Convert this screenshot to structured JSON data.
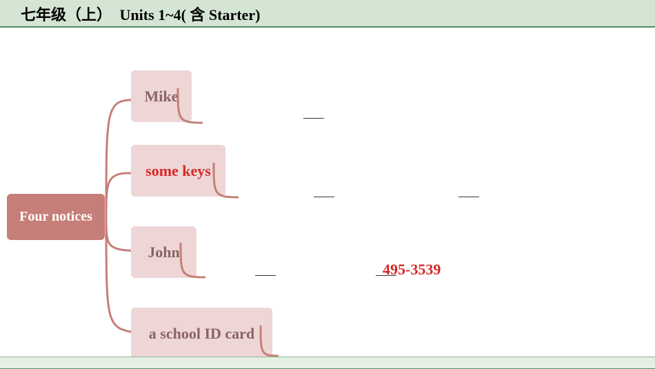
{
  "header": {
    "zh": "七年级（上）",
    "en": "Units 1~4( 含 Starter)"
  },
  "root": {
    "label": "Four notices"
  },
  "children": [
    {
      "label": "Mike"
    },
    {
      "label": "some keys"
    },
    {
      "label": "John"
    },
    {
      "label": "a school ID card"
    }
  ],
  "phone": "495-3539",
  "chart_data": {
    "type": "tree",
    "root": "Four notices",
    "nodes": [
      {
        "label": "Mike",
        "detail_slots": 1
      },
      {
        "label": "some keys",
        "detail_slots": 2
      },
      {
        "label": "John",
        "detail_slots": 2,
        "phone": "495-3539"
      },
      {
        "label": "a school ID card",
        "detail_slots": 0
      }
    ]
  }
}
